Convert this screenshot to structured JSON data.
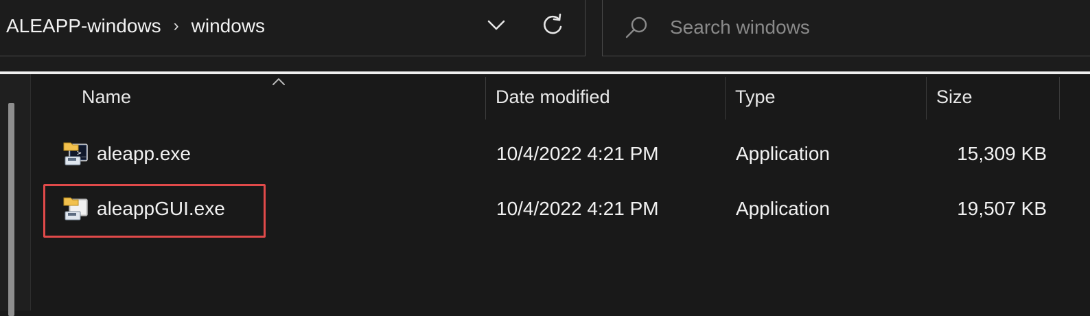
{
  "address_bar": {
    "breadcrumbs": [
      "ALEAPP-windows",
      "windows"
    ],
    "separator": "›"
  },
  "search": {
    "placeholder": "Search windows",
    "value": ""
  },
  "columns": [
    {
      "label": "Name"
    },
    {
      "label": "Date modified"
    },
    {
      "label": "Type"
    },
    {
      "label": "Size"
    }
  ],
  "files": [
    {
      "name": "aleapp.exe",
      "date_modified": "10/4/2022 4:21 PM",
      "type": "Application",
      "size": "15,309 KB",
      "icon": "application-exe-icon"
    },
    {
      "name": "aleappGUI.exe",
      "date_modified": "10/4/2022 4:21 PM",
      "type": "Application",
      "size": "19,507 KB",
      "icon": "application-exe-icon"
    }
  ],
  "colors": {
    "background": "#191919",
    "highlight": "#e04a4a",
    "text": "#f2f2f2",
    "placeholder": "#8a8a8a"
  }
}
